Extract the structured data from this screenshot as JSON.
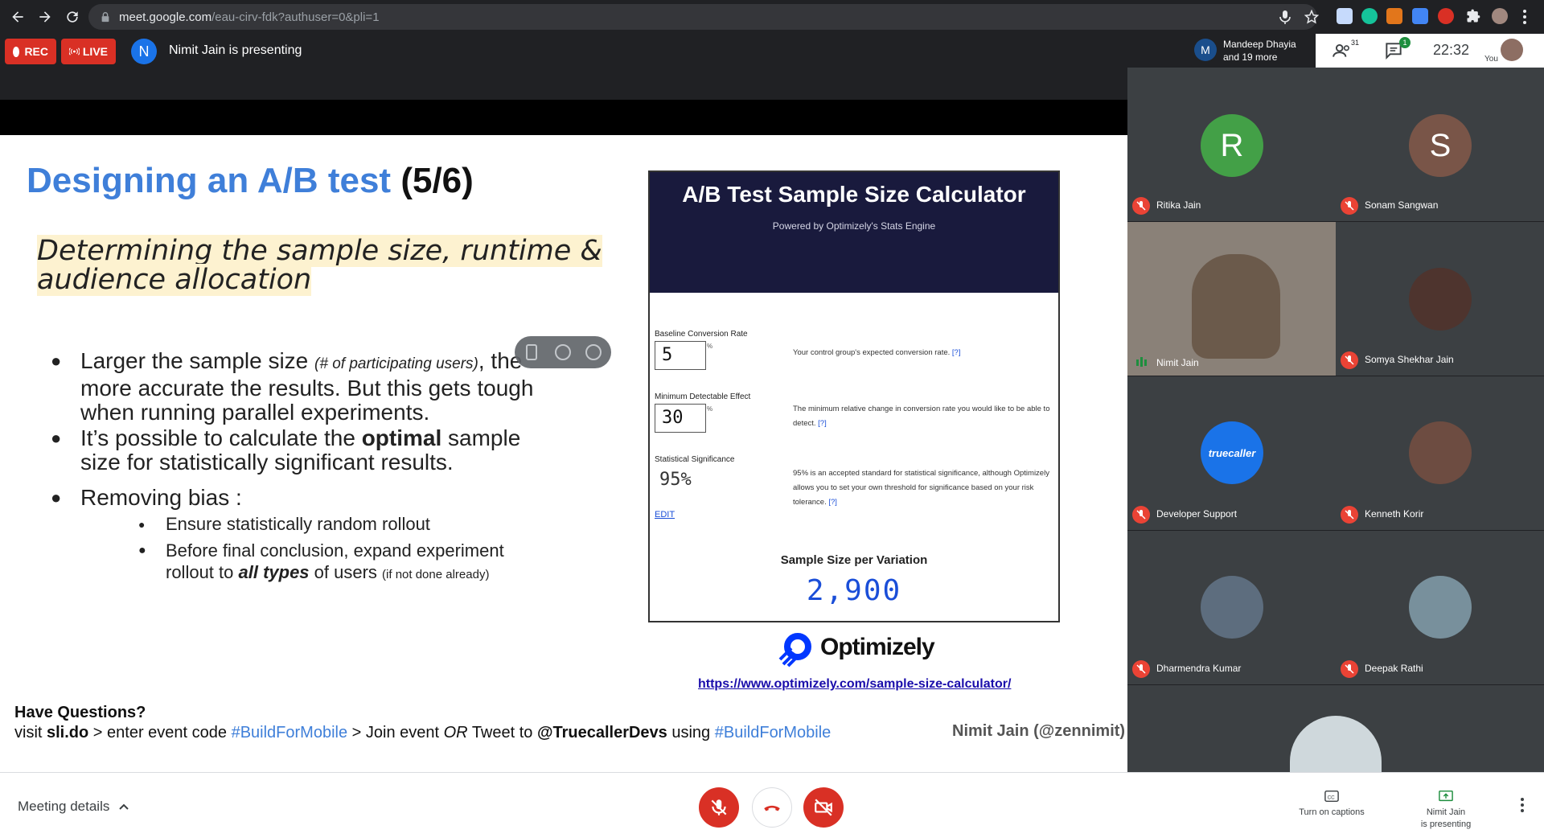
{
  "browser": {
    "url_host": "meet.google.com",
    "url_path": "/eau-cirv-fdk?authuser=0&pli=1"
  },
  "meet_top": {
    "rec_label": "REC",
    "live_label": "LIVE",
    "presenter_initial": "N",
    "presenter_text": "Nimit Jain is presenting",
    "viewers_initial": "M",
    "viewers_line1": "Mandeep Dhayia",
    "viewers_line2": "and 19 more",
    "people_count": "31",
    "chat_count": "1",
    "clock": "22:32",
    "you_label": "You"
  },
  "slide": {
    "title": "Designing an A/B test",
    "title_num": "(5/6)",
    "subtitle_line1": "Determining the sample size, runtime &",
    "subtitle_line2": "audience allocation",
    "b1_a": "Larger the sample size ",
    "b1_small": "(# of participating users)",
    "b1_b": ", the",
    "b1_line2": "more accurate the results. But this gets tough",
    "b1_line3": "when running parallel experiments.",
    "b2_a": "It’s possible to calculate the ",
    "b2_bold": "optimal",
    "b2_b": " sample",
    "b2_line2": "size for statistically significant results.",
    "b3": "Removing bias :",
    "b3_sub1": "Ensure statistically random rollout",
    "b3_sub2_line1": "Before final conclusion, expand experiment",
    "b3_sub2_a": "rollout to ",
    "b3_sub2_bold": "all types",
    "b3_sub2_b": " of users ",
    "b3_sub2_tiny": "(if not done already)",
    "footer_q": "Have Questions?",
    "footer_visit": "visit ",
    "footer_slido": "sli.do",
    "footer_mid": " > enter event code ",
    "footer_tag1": "#BuildForMobile",
    "footer_join": " > Join event ",
    "footer_or": "OR",
    "footer_tweet": " Tweet to ",
    "footer_handle": "@TruecallerDevs",
    "footer_using": " using ",
    "footer_tag2": "#BuildForMobile",
    "footer_name": "Nimit Jain (@zennimit)"
  },
  "calculator": {
    "title": "A/B Test Sample Size Calculator",
    "subtitle": "Powered by Optimizely's Stats Engine",
    "baseline_label": "Baseline Conversion Rate",
    "baseline_value": "5",
    "baseline_desc": "Your control group's expected conversion rate.",
    "mde_label": "Minimum Detectable Effect",
    "mde_value": "30",
    "mde_desc": "The minimum relative change in conversion rate you would like to be able to detect.",
    "sig_label": "Statistical Significance",
    "sig_value": "95%",
    "sig_desc": "95% is an accepted standard for statistical significance, although Optimizely allows you to set your own threshold for significance based on your risk tolerance.",
    "help": "[?]",
    "pct": "%",
    "edit": "EDIT",
    "sample_label": "Sample Size per Variation",
    "sample_value": "2,900",
    "brand": "Optimizely",
    "link": "https://www.optimizely.com/sample-size-calculator/"
  },
  "participants": [
    {
      "name": "Ritika Jain",
      "initial": "R",
      "color": "#43a047"
    },
    {
      "name": "Sonam Sangwan",
      "initial": "S",
      "color": "#795548"
    },
    {
      "name": "Nimit Jain"
    },
    {
      "name": "Somya Shekhar Jain"
    },
    {
      "name": "Developer Support",
      "initial": "truecaller",
      "color": "#1a73e8"
    },
    {
      "name": "Kenneth Korir"
    },
    {
      "name": "Dharmendra Kumar"
    },
    {
      "name": "Deepak Rathi"
    }
  ],
  "bottom": {
    "details": "Meeting details",
    "captions": "Turn on captions",
    "presenting_line1": "Nimit Jain",
    "presenting_line2": "is presenting"
  },
  "colors": {
    "accent": "#1a73e8",
    "danger": "#ea4335",
    "slide_title": "#3f7fd9"
  }
}
